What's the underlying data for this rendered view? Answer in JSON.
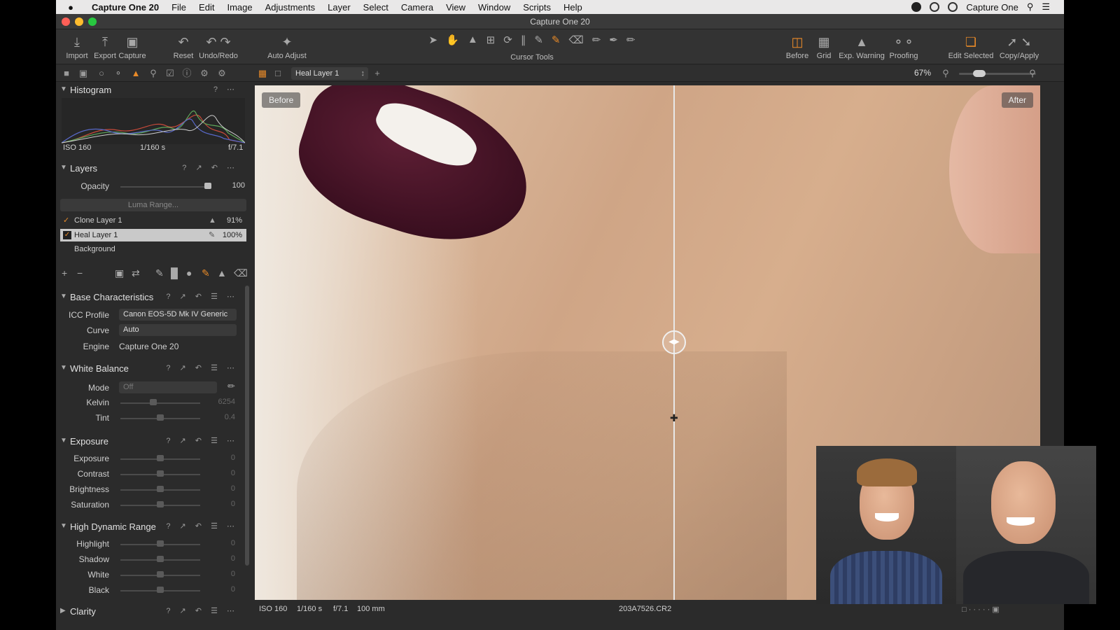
{
  "menubar": {
    "app_name": "Capture One 20",
    "items": [
      "File",
      "Edit",
      "Image",
      "Adjustments",
      "Layer",
      "Select",
      "Camera",
      "View",
      "Window",
      "Scripts",
      "Help"
    ],
    "right_label": "Capture One"
  },
  "window": {
    "title": "Capture One 20"
  },
  "toolbar": {
    "import": "Import",
    "export": "Export",
    "capture": "Capture",
    "reset": "Reset",
    "undo_redo": "Undo/Redo",
    "auto_adjust": "Auto Adjust",
    "cursor_tools": "Cursor Tools",
    "before": "Before",
    "grid": "Grid",
    "exp_warning": "Exp. Warning",
    "proofing": "Proofing",
    "edit_selected": "Edit Selected",
    "copy_apply": "Copy/Apply"
  },
  "viewer_bar": {
    "layer": "Heal Layer 1",
    "zoom": "67%"
  },
  "histogram": {
    "title": "Histogram",
    "iso": "ISO 160",
    "shutter": "1/160 s",
    "aperture": "f/7.1"
  },
  "layers": {
    "title": "Layers",
    "opacity_label": "Opacity",
    "opacity_value": "100",
    "luma_range": "Luma Range...",
    "items": [
      {
        "name": "Clone Layer 1",
        "opacity": "91%"
      },
      {
        "name": "Heal Layer 1",
        "opacity": "100%"
      },
      {
        "name": "Background"
      }
    ]
  },
  "base_characteristics": {
    "title": "Base Characteristics",
    "icc_label": "ICC Profile",
    "icc_value": "Canon EOS-5D Mk IV Generic",
    "curve_label": "Curve",
    "curve_value": "Auto",
    "engine_label": "Engine",
    "engine_value": "Capture One 20"
  },
  "white_balance": {
    "title": "White Balance",
    "mode_label": "Mode",
    "mode_value": "Off",
    "kelvin_label": "Kelvin",
    "kelvin_value": "6254",
    "tint_label": "Tint",
    "tint_value": "0.4"
  },
  "exposure": {
    "title": "Exposure",
    "rows": [
      {
        "label": "Exposure",
        "value": "0"
      },
      {
        "label": "Contrast",
        "value": "0"
      },
      {
        "label": "Brightness",
        "value": "0"
      },
      {
        "label": "Saturation",
        "value": "0"
      }
    ]
  },
  "hdr": {
    "title": "High Dynamic Range",
    "rows": [
      {
        "label": "Highlight",
        "value": "0"
      },
      {
        "label": "Shadow",
        "value": "0"
      },
      {
        "label": "White",
        "value": "0"
      },
      {
        "label": "Black",
        "value": "0"
      }
    ]
  },
  "clarity": {
    "title": "Clarity"
  },
  "viewer": {
    "before_label": "Before",
    "after_label": "After"
  },
  "status": {
    "iso": "ISO 160",
    "shutter": "1/160 s",
    "aperture": "f/7.1",
    "focal": "100 mm",
    "filename": "203A7526.CR2"
  }
}
